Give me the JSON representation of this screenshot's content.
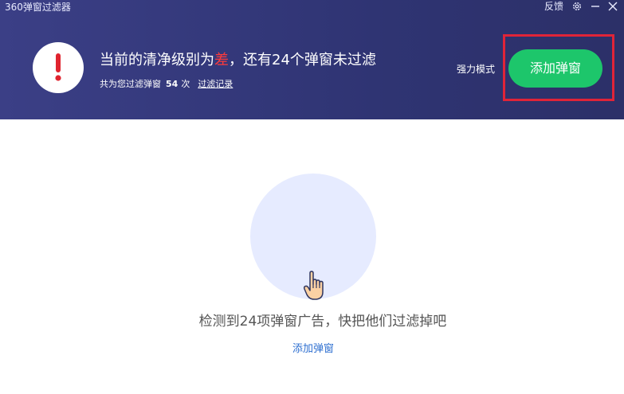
{
  "window": {
    "title": "360弹窗过滤器",
    "feedback_label": "反馈",
    "settings_icon": "gear-icon",
    "minimize_icon": "minimize-icon",
    "close_icon": "close-icon"
  },
  "header": {
    "alert_icon": "exclamation-icon",
    "status_prefix": "当前的清净级别为",
    "status_level": "差",
    "status_suffix": "，还有24个弹窗未过滤",
    "filtered_prefix": "共为您过滤弹窗",
    "filtered_count": "54",
    "filtered_unit": "次",
    "history_link": "过滤记录",
    "mode_label": "强力模式",
    "add_button_label": "添加弹窗"
  },
  "main": {
    "hand_icon": "pointing-hand-icon",
    "message": "检测到24项弹窗广告，快把他们过滤掉吧",
    "link_label": "添加弹窗"
  },
  "colors": {
    "header_bg": "#33387a",
    "status_level": "#ff3b3b",
    "primary_button": "#1dc66b",
    "highlight_border": "#e02438",
    "illustration_bg": "#e6ebff",
    "link": "#2e6fd0"
  }
}
